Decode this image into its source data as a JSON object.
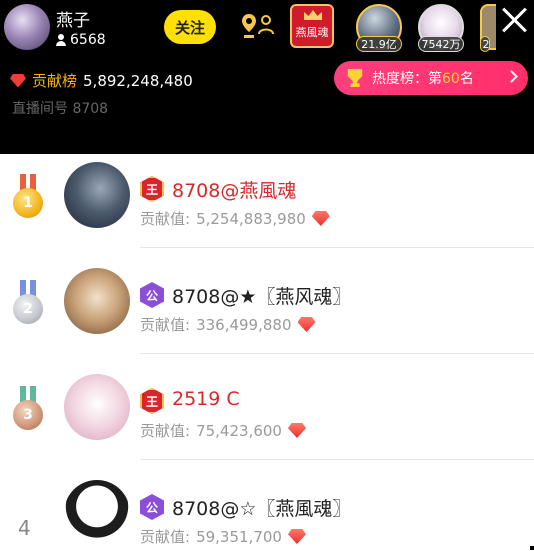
{
  "host": {
    "name": "燕子",
    "fans": "6568",
    "follow_label": "关注",
    "rank_badge_label": "燕風魂",
    "contribution_label": "贡献榜",
    "contribution_value": "5,892,248,480",
    "room_label": "直播间号 8708",
    "hot_rank_prefix": "热度榜：第",
    "hot_rank_num": "60",
    "hot_rank_suffix": "名"
  },
  "viewers": [
    {
      "tag": "21.9亿"
    },
    {
      "tag": "7542万"
    },
    {
      "tag": "2"
    }
  ],
  "list": [
    {
      "rank": "1",
      "level": "王",
      "name": "8708@燕風魂",
      "contribution_label": "贡献值:",
      "contribution": "5,254,883,980"
    },
    {
      "rank": "2",
      "level": "公",
      "name": "8708@★〖燕风魂〗",
      "contribution_label": "贡献值:",
      "contribution": "336,499,880"
    },
    {
      "rank": "3",
      "level": "王",
      "name": "2519 C",
      "contribution_label": "贡献值:",
      "contribution": "75,423,600"
    },
    {
      "rank": "4",
      "level": "公",
      "name": "8708@☆〖燕風魂〗",
      "contribution_label": "贡献值:",
      "contribution": "59,351,700"
    }
  ],
  "colors": {
    "accent_yellow": "#ffe000",
    "hot_pink": "#ff2f6a",
    "name_red": "#d42a2a",
    "gem_red": "#ee2e2e"
  },
  "icons": {
    "close": "close-icon",
    "gem": "gem-icon",
    "trophy": "trophy-icon",
    "person": "person-icon",
    "location": "location-icon"
  }
}
